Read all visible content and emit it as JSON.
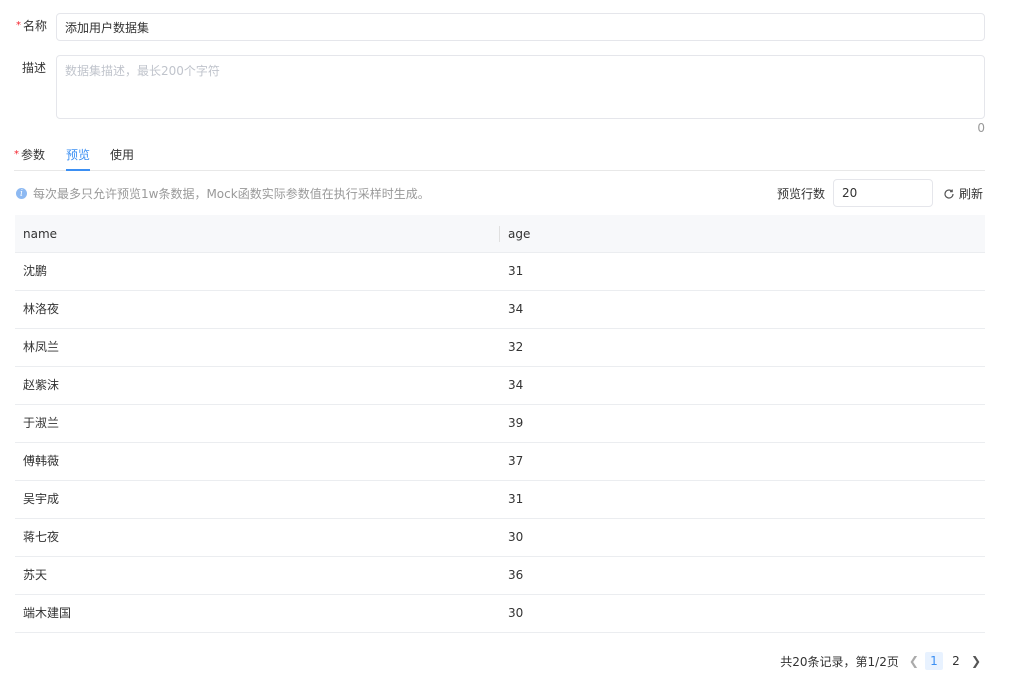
{
  "form": {
    "name_label": "名称",
    "name_value": "添加用户数据集",
    "desc_label": "描述",
    "desc_placeholder": "数据集描述，最长200个字符",
    "desc_count": "0"
  },
  "tabs": [
    {
      "label": "参数",
      "required": true
    },
    {
      "label": "预览",
      "active": true
    },
    {
      "label": "使用"
    }
  ],
  "preview": {
    "info_text": "每次最多只允许预览1w条数据，Mock函数实际参数值在执行采样时生成。",
    "rows_label": "预览行数",
    "rows_value": "20",
    "refresh_label": "刷新"
  },
  "table": {
    "columns": [
      "name",
      "age"
    ],
    "rows": [
      [
        "沈鹏",
        "31"
      ],
      [
        "林洛夜",
        "34"
      ],
      [
        "林凤兰",
        "32"
      ],
      [
        "赵紫沫",
        "34"
      ],
      [
        "于淑兰",
        "39"
      ],
      [
        "傅韩薇",
        "37"
      ],
      [
        "吴宇成",
        "31"
      ],
      [
        "蒋七夜",
        "30"
      ],
      [
        "苏天",
        "36"
      ],
      [
        "端木建国",
        "30"
      ]
    ]
  },
  "pagination": {
    "summary": "共20条记录，第1/2页",
    "pages": [
      "1",
      "2"
    ],
    "current": "1"
  },
  "colors": {
    "accent": "#3b8ff3",
    "required": "#f5222d",
    "header_bg": "#f7f8fa"
  }
}
